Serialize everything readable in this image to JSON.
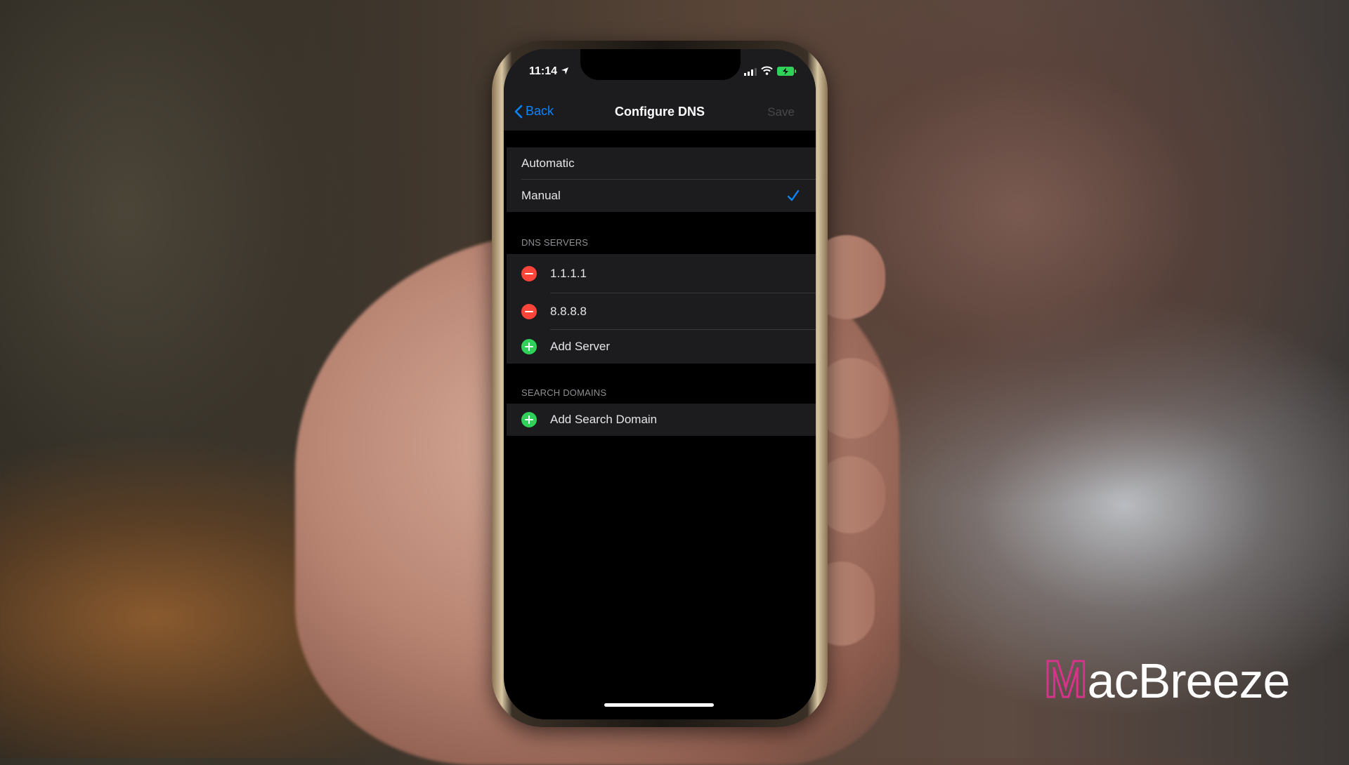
{
  "status_bar": {
    "time": "11:14",
    "icons": [
      "location-arrow-icon",
      "cellular-signal-icon",
      "wifi-icon",
      "battery-charging-icon"
    ],
    "battery_color": "#30d158"
  },
  "nav": {
    "back_label": "Back",
    "title": "Configure DNS",
    "save_label": "Save"
  },
  "mode": {
    "options": [
      {
        "label": "Automatic",
        "selected": false
      },
      {
        "label": "Manual",
        "selected": true
      }
    ]
  },
  "dns_servers": {
    "header": "DNS SERVERS",
    "servers": [
      "1.1.1.1",
      "8.8.8.8"
    ],
    "add_label": "Add Server"
  },
  "search_domains": {
    "header": "SEARCH DOMAINS",
    "add_label": "Add Search Domain"
  },
  "colors": {
    "accent": "#0a84ff",
    "delete": "#ff453a",
    "add": "#30d158"
  },
  "watermark": {
    "first_letter": "M",
    "rest": "acBreeze",
    "accent": "#d6338a"
  }
}
